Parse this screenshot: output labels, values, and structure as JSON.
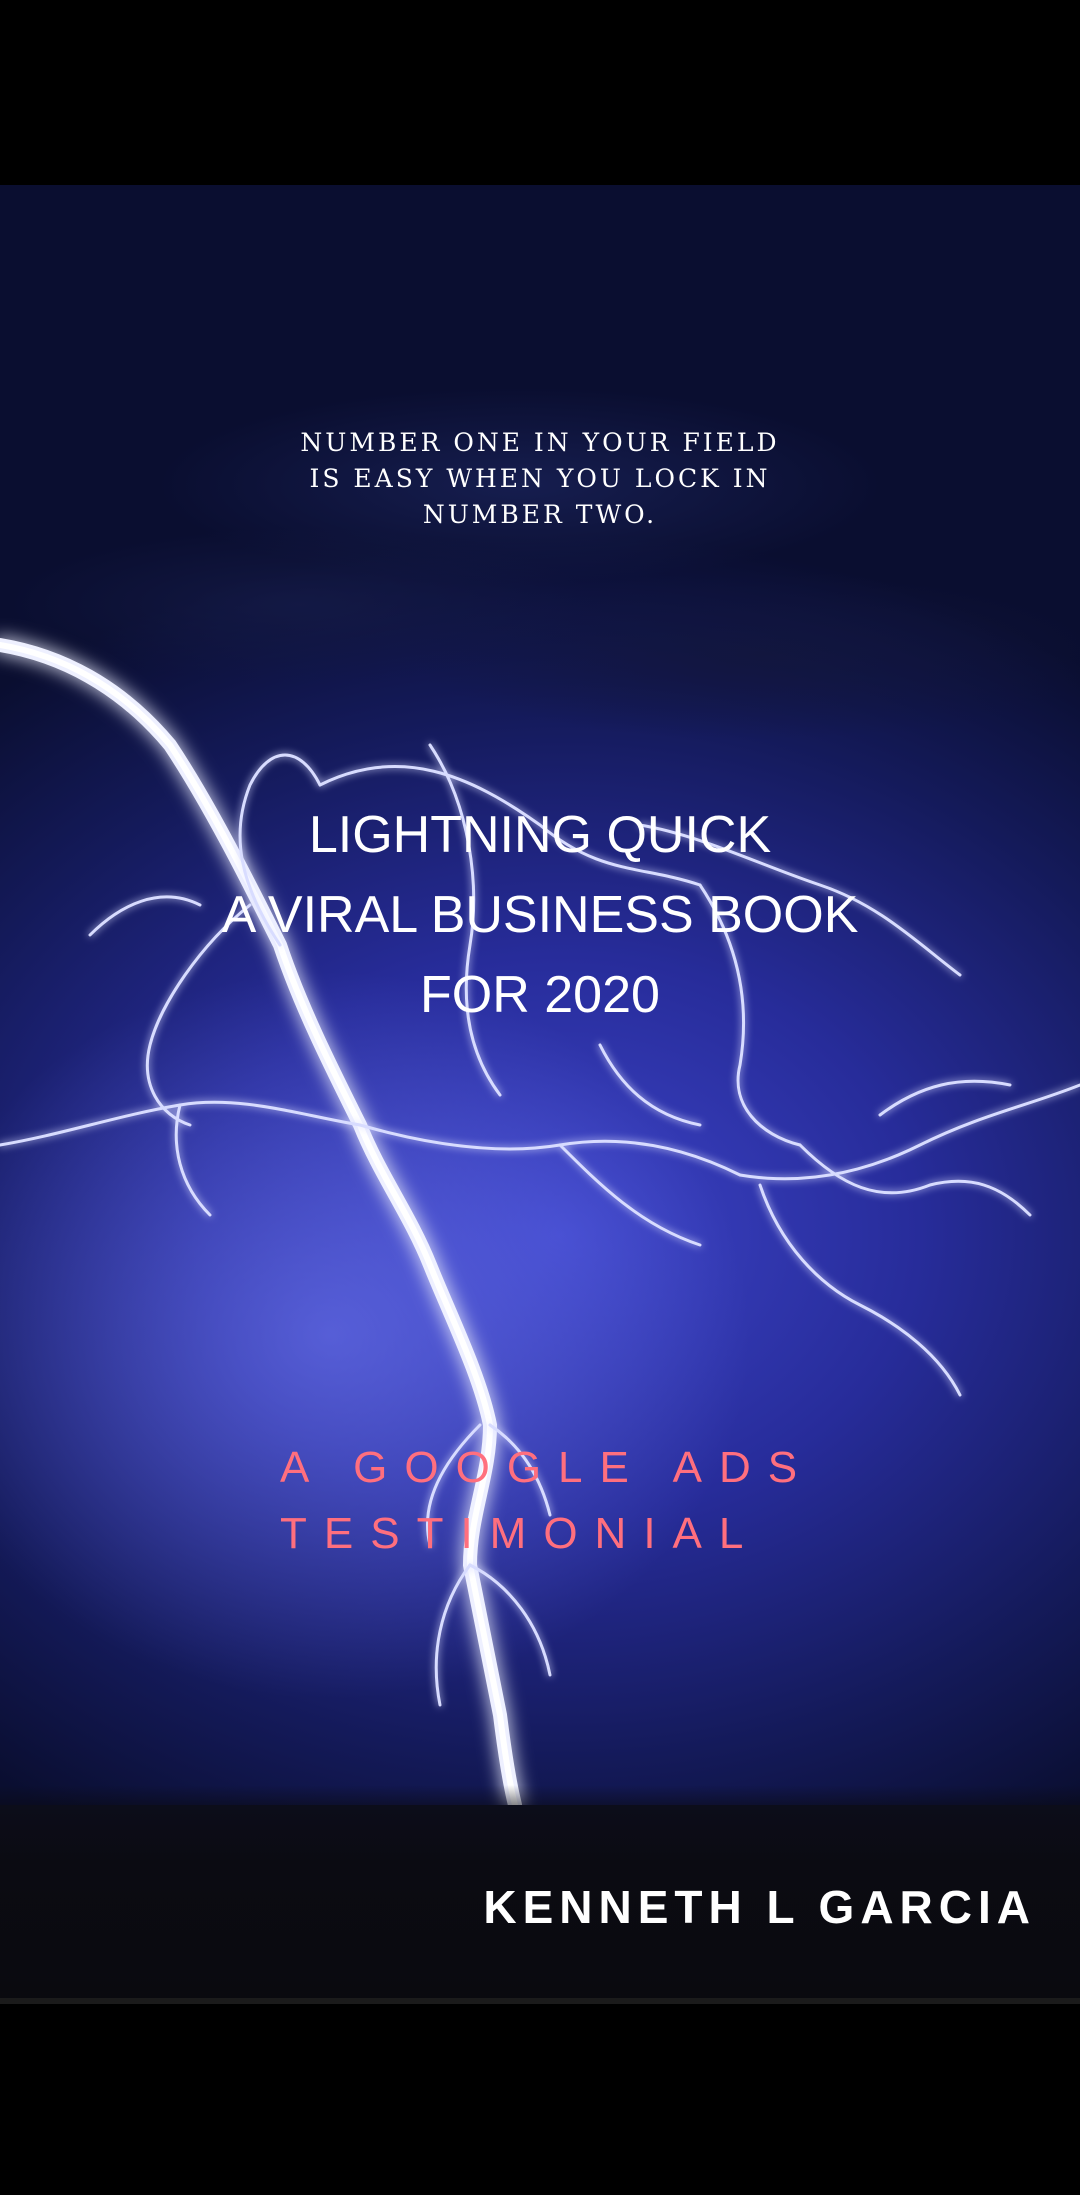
{
  "cover": {
    "tagline": [
      "NUMBER ONE IN YOUR FIELD",
      "IS EASY WHEN YOU LOCK IN",
      "NUMBER TWO."
    ],
    "title": [
      "LIGHTNING QUICK",
      "A VIRAL BUSINESS BOOK",
      "FOR 2020"
    ],
    "subtitle": [
      "A GOOGLE ADS",
      "TESTIMONIAL"
    ],
    "author": "KENNETH L GARCIA",
    "colors": {
      "sky": "#272c9a",
      "subtitle": "#ff6f7e",
      "text": "#ffffff",
      "frame": "#000000"
    },
    "image": "lightning-bolt-illustration"
  }
}
